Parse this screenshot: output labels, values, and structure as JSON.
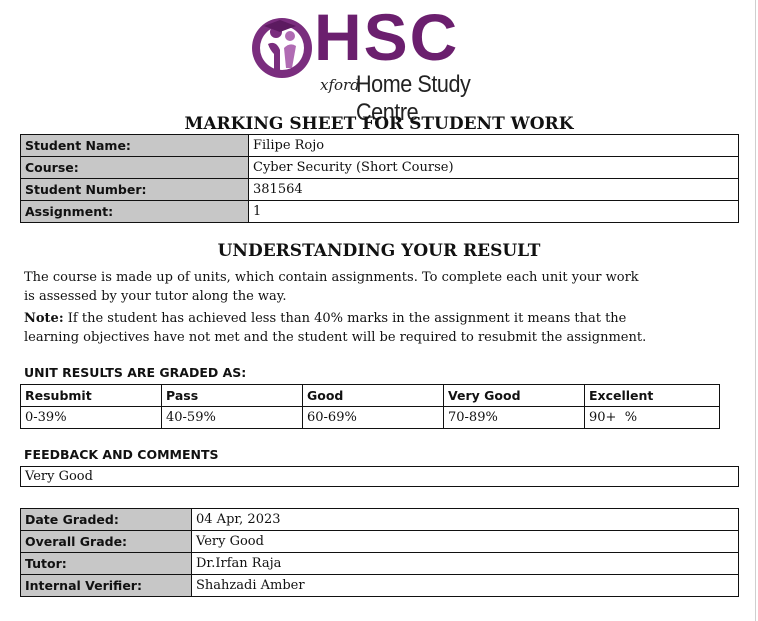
{
  "logo": {
    "brand": "HSC",
    "oxford": "xford",
    "centre": "Home Study Centre"
  },
  "title": "MARKING SHEET FOR STUDENT WORK",
  "student_info": [
    {
      "label": "Student Name:",
      "value": "Filipe Rojo"
    },
    {
      "label": "Course:",
      "value": "Cyber Security (Short Course)"
    },
    {
      "label": "Student Number:",
      "value": "381564"
    },
    {
      "label": "Assignment:",
      "value": "1"
    }
  ],
  "understanding": {
    "heading": "UNDERSTANDING YOUR RESULT",
    "line1": "The course is made up of units, which contain assignments. To complete each unit your work",
    "line2": "is assessed by your tutor along the way.",
    "note_label": "Note:",
    "note_line1": " If the student has achieved less than 40% marks in the assignment it means that the",
    "note_line2": "learning objectives have not met and the student will be required to resubmit the assignment."
  },
  "grading": {
    "heading": "UNIT RESULTS ARE GRADED AS:",
    "headers": [
      "Resubmit",
      "Pass",
      "Good",
      "Very Good",
      "Excellent"
    ],
    "ranges": [
      "0-39%",
      "40-59%",
      "60-69%",
      "70-89%",
      "90+  %"
    ]
  },
  "feedback": {
    "heading": "FEEDBACK AND COMMENTS",
    "text": "Very Good"
  },
  "result_info": [
    {
      "label": "Date Graded:",
      "value": "04 Apr, 2023"
    },
    {
      "label": "Overall Grade:",
      "value": "Very Good"
    },
    {
      "label": "Tutor:",
      "value": "Dr.Irfan Raja"
    },
    {
      "label": "Internal Verifier:",
      "value": "Shahzadi Amber"
    }
  ],
  "colors": {
    "brand_purple": "#6b1f6e",
    "label_gray": "#c7c7c7"
  }
}
